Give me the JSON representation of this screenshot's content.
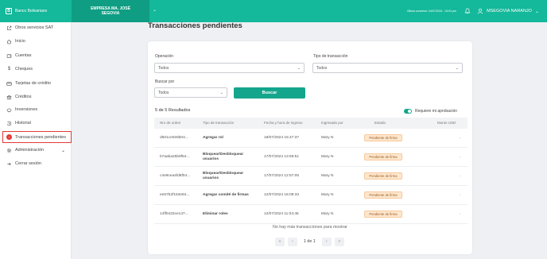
{
  "header": {
    "brand": "Banco Bolivariano",
    "company": "EMPRESA MA. JOSÉ SEGOVIA",
    "last_connection": "Última conexión: 24/07/2024 - 02:51 pm",
    "username": "MSEGOVIA NARANJO"
  },
  "sidebar": {
    "items": [
      {
        "label": "Otros servicios SAT",
        "icon": "external-link-icon"
      },
      {
        "label": "Inicio",
        "icon": "home-icon"
      },
      {
        "label": "Cuentas",
        "icon": "wallet-icon"
      },
      {
        "label": "Cheques",
        "icon": "dollar-icon"
      },
      {
        "label": "Tarjetas de crédito",
        "icon": "credit-card-icon"
      },
      {
        "label": "Créditos",
        "icon": "bank-icon"
      },
      {
        "label": "Inversiones",
        "icon": "piggy-icon"
      },
      {
        "label": "Historial",
        "icon": "history-icon"
      },
      {
        "label": "Transacciones pendientes",
        "icon": "alert-icon",
        "badge": "!"
      },
      {
        "label": "Administración",
        "icon": "gear-icon"
      },
      {
        "label": "Cerrar sesión",
        "icon": "logout-icon"
      }
    ]
  },
  "main": {
    "title": "Transacciones pendientes",
    "filters": {
      "operacion_label": "Operación",
      "operacion_value": "Todos",
      "tipo_label": "Tipo de transacción",
      "tipo_value": "Todos",
      "buscar_label": "Buscar por",
      "buscar_value": "Todos",
      "search_button": "Buscar"
    },
    "results": "5 de 5 Resultados",
    "toggle_label": "Requiere mi aprobación",
    "columns": [
      "Nro de orden",
      "Tipo de transacción",
      "Fecha y hora de ingreso",
      "Ingresado por",
      "Estado",
      "Monto USD"
    ],
    "rows": [
      {
        "order": "d501ce026b04...",
        "type": "Agregar rol",
        "date": "18/07/2024 15:47:37",
        "by": "Mary N",
        "status": "Pendiente de firma",
        "amount": "-"
      },
      {
        "order": "b7aaba25b9f54...",
        "type": "Bloquear/Desbloquear usuarios",
        "date": "17/07/2024 13:59:51",
        "by": "Mary N",
        "status": "Pendiente de firma",
        "amount": "-"
      },
      {
        "order": "c4e9cea4fd6f04...",
        "type": "Bloquear/Desbloquear usuarios",
        "date": "17/07/2024 12:57:05",
        "by": "Mary N",
        "status": "Pendiente de firma",
        "amount": "-"
      },
      {
        "order": "ee57b2f153e64...",
        "type": "Agregar comité de firmas",
        "date": "12/07/2024 16:09:33",
        "by": "Mary N",
        "status": "Pendiente de firma",
        "amount": "-"
      },
      {
        "order": "14ff0433ce147...",
        "type": "Eliminar roles",
        "date": "12/07/2024 11:04:46",
        "by": "Mary N",
        "status": "Pendiente de firma",
        "amount": "-"
      }
    ],
    "no_more": "No hay más transacciones para mostrar",
    "pagination": "1 de 1"
  },
  "colors": {
    "primary": "#14b89a",
    "button": "#14a58d",
    "badge_bg": "#fde7cf",
    "active_border": "#e53935"
  }
}
